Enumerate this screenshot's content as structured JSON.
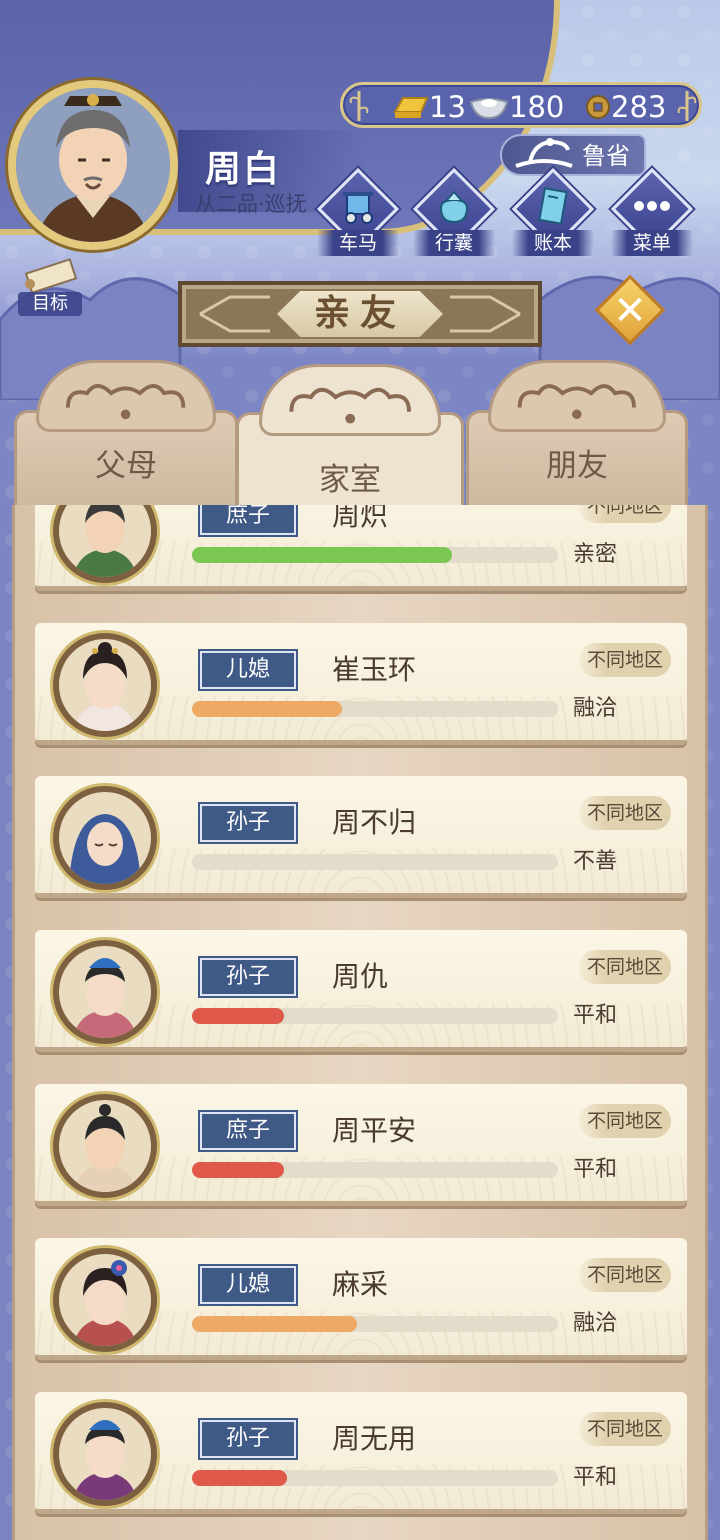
{
  "player": {
    "name": "周白",
    "rank": "从二品·巡抚"
  },
  "currency": {
    "gold": "13",
    "silver": "180",
    "coin": "283"
  },
  "region": "鲁省",
  "nav": [
    {
      "label": "车马",
      "icon": "carriage-icon"
    },
    {
      "label": "行囊",
      "icon": "bundle-icon"
    },
    {
      "label": "账本",
      "icon": "ledger-icon"
    },
    {
      "label": "菜单",
      "icon": "menu-dots-icon"
    }
  ],
  "goal_label": "目标",
  "title": "亲友",
  "tabs": [
    {
      "label": "父母",
      "active": false
    },
    {
      "label": "家室",
      "active": true
    },
    {
      "label": "朋友",
      "active": false
    }
  ],
  "members": [
    {
      "relation": "庶子",
      "name": "周炽",
      "area": "不同地区",
      "attitude": "亲密",
      "favor": 0.71,
      "bar_color": "#7cc654"
    },
    {
      "relation": "儿媳",
      "name": "崔玉环",
      "area": "不同地区",
      "attitude": "融洽",
      "favor": 0.41,
      "bar_color": "#eea965"
    },
    {
      "relation": "孙子",
      "name": "周不归",
      "area": "不同地区",
      "attitude": "不善",
      "favor": 0.0,
      "bar_color": "#e0584a"
    },
    {
      "relation": "孙子",
      "name": "周仇",
      "area": "不同地区",
      "attitude": "平和",
      "favor": 0.25,
      "bar_color": "#e0584a"
    },
    {
      "relation": "庶子",
      "name": "周平安",
      "area": "不同地区",
      "attitude": "平和",
      "favor": 0.25,
      "bar_color": "#e0584a"
    },
    {
      "relation": "儿媳",
      "name": "麻采",
      "area": "不同地区",
      "attitude": "融洽",
      "favor": 0.45,
      "bar_color": "#eea965"
    },
    {
      "relation": "孙子",
      "name": "周无用",
      "area": "不同地区",
      "attitude": "平和",
      "favor": 0.26,
      "bar_color": "#e0584a"
    }
  ]
}
